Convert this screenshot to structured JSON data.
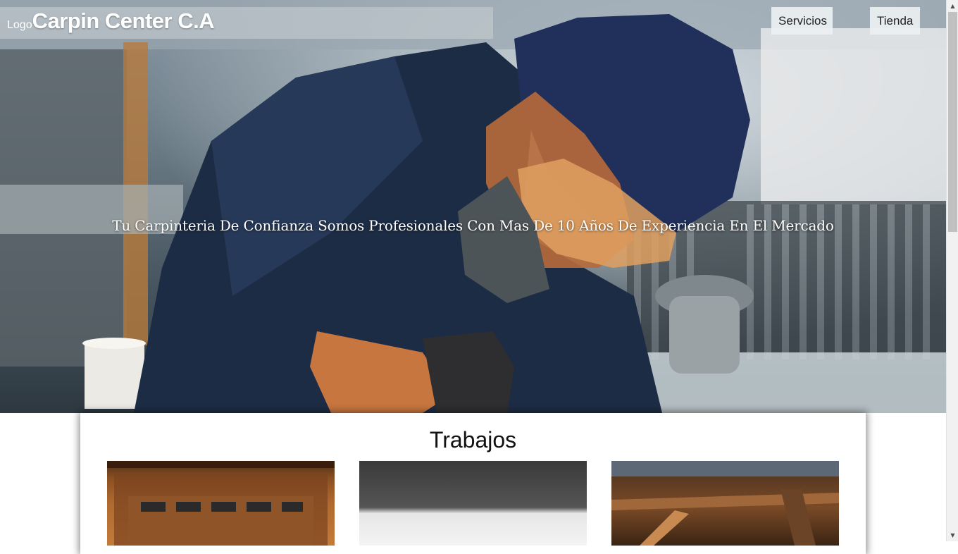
{
  "header": {
    "logo_text": "Logo",
    "site_title": "Carpin Center C.A",
    "nav": [
      {
        "label": "Servicios"
      },
      {
        "label": "Tienda"
      }
    ]
  },
  "hero": {
    "tagline": "Tu Carpinteria De Confianza Somos Profesionales Con Mas De 10 Años De Experiencia En El Mercado"
  },
  "trabajos": {
    "title": "Trabajos"
  },
  "colors": {
    "hero_overlay_text": "#ffffff",
    "nav_button_bg": "#ebf0f2",
    "panel_bg": "#ffffff"
  }
}
